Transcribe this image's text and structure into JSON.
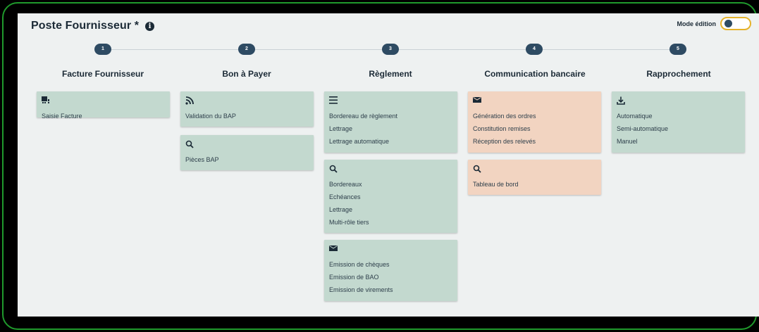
{
  "header": {
    "title": "Poste Fournisseur *",
    "mode_label": "Mode édition",
    "mode_enabled": false
  },
  "colors": {
    "green_card": "#c3d9cf",
    "peach_card": "#f2d4c1",
    "badge": "#2e4b63",
    "toggle_border": "#e5b22a",
    "frame_border": "#1f9a2c"
  },
  "steps": [
    {
      "number": "1",
      "title": "Facture Fournisseur",
      "cards": [
        {
          "icon": "invoice-icon",
          "color": "green",
          "items": [
            "Saisie Facture"
          ]
        }
      ]
    },
    {
      "number": "2",
      "title": "Bon à Payer",
      "cards": [
        {
          "icon": "rss-icon",
          "color": "green",
          "items": [
            "Validation du BAP"
          ]
        },
        {
          "icon": "search-icon",
          "color": "green",
          "items": [
            "Pièces BAP"
          ]
        }
      ]
    },
    {
      "number": "3",
      "title": "Règlement",
      "cards": [
        {
          "icon": "menu-icon",
          "color": "green",
          "items": [
            "Bordereau de règlement",
            "Lettrage",
            "Lettrage automatique"
          ]
        },
        {
          "icon": "search-icon",
          "color": "green",
          "items": [
            "Bordereaux",
            "Echéances",
            "Lettrage",
            "Multi-rôle tiers"
          ]
        },
        {
          "icon": "mail-icon",
          "color": "green",
          "items": [
            "Emission de chèques",
            "Emission de BAO",
            "Emission de virements"
          ]
        }
      ]
    },
    {
      "number": "4",
      "title": "Communication bancaire",
      "cards": [
        {
          "icon": "mail-icon",
          "color": "peach",
          "items": [
            "Génération des ordres",
            "Constitution remises",
            "Réception des relevés"
          ]
        },
        {
          "icon": "search-icon",
          "color": "peach",
          "items": [
            "Tableau de bord"
          ]
        }
      ]
    },
    {
      "number": "5",
      "title": "Rapprochement",
      "cards": [
        {
          "icon": "download-icon",
          "color": "green",
          "items": [
            "Automatique",
            "Semi-automatique",
            "Manuel"
          ]
        }
      ]
    }
  ]
}
